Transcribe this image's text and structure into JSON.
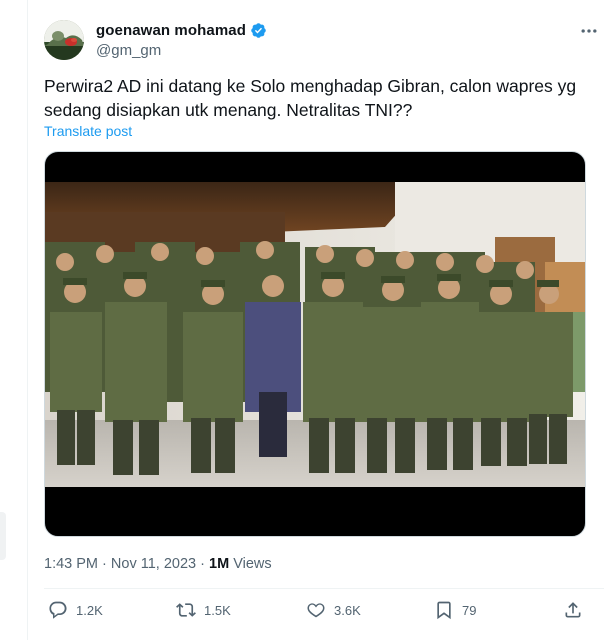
{
  "author": {
    "display_name": "goenawan mohamad",
    "handle": "@gm_gm",
    "verified_color": "#1d9bf0"
  },
  "tweet": {
    "text": "Perwira2 AD ini datang ke Solo menghadap Gibran, calon wapres yg sedang disiapkan utk menang.  Netralitas TNI??",
    "translate_label": "Translate post"
  },
  "meta": {
    "time": "1:43 PM",
    "separator": "·",
    "date": "Nov 11, 2023",
    "views_count": "1M",
    "views_label": "Views"
  },
  "actions": {
    "reply_count": "1.2K",
    "repost_count": "1.5K",
    "like_count": "3.6K",
    "bookmark_count": "79"
  },
  "icons": {
    "more": "more-icon",
    "reply": "reply-icon",
    "repost": "repost-icon",
    "like": "heart-icon",
    "bookmark": "bookmark-icon",
    "share": "share-icon"
  },
  "colors": {
    "accent": "#1d9bf0",
    "secondary_text": "#536471",
    "primary_text": "#0f1419"
  }
}
